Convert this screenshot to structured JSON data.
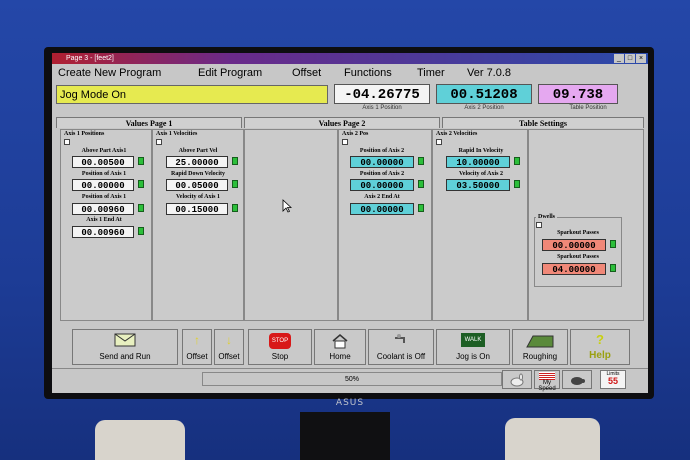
{
  "window": {
    "title": "Page 3 - [feet2]"
  },
  "menu": [
    "Create New Program",
    "Edit Program",
    "Offset",
    "Functions",
    "Timer",
    "Ver 7.0.8"
  ],
  "mode": {
    "text": "Jog Mode On",
    "color": "#e6ea50"
  },
  "positions": [
    {
      "value": "-04.26775",
      "label": "Axis 1 Position",
      "color": "#f4f4f4"
    },
    {
      "value": "00.51208",
      "label": "Axis 2 Position",
      "color": "#5fd0d8"
    },
    {
      "value": "09.738",
      "label": "Table Position",
      "color": "#e5a8f0"
    }
  ],
  "tabs": [
    "Values Page 1",
    "Values Page 2",
    "Table Settings"
  ],
  "axis1_positions": {
    "group": "Axis 1 Positions",
    "fields": [
      {
        "label": "Above Part Axis1",
        "value": "00.00500"
      },
      {
        "label": "Position of Axis 1",
        "value": "00.00000"
      },
      {
        "label": "Position of Axis 1",
        "value": "00.00960"
      },
      {
        "label": "Axis 1 End At",
        "value": "00.00960"
      }
    ]
  },
  "axis1_velocities": {
    "group": "Axis 1 Velocities",
    "fields": [
      {
        "label": "Above Part Vel",
        "value": "25.00000"
      },
      {
        "label": "Rapid Down Velocity",
        "value": "00.05000"
      },
      {
        "label": "Velocity of Axis 1",
        "value": "00.15000"
      }
    ]
  },
  "axis2_pos": {
    "group": "Axis 2 Pos",
    "fields": [
      {
        "label": "Position of Axis 2",
        "value": "00.00000"
      },
      {
        "label": "Position of Axis 2",
        "value": "00.00000"
      },
      {
        "label": "Axis 2 End At",
        "value": "00.00000"
      }
    ]
  },
  "axis2_velocities": {
    "group": "Axis 2 Velocities",
    "fields": [
      {
        "label": "Rapid In Velocity",
        "value": "10.00000"
      },
      {
        "label": "Velocity of Axis 2",
        "value": "03.50000"
      }
    ]
  },
  "dwells": {
    "group": "Dwells",
    "fields": [
      {
        "label": "Sparkout Passes",
        "value": "00.00000"
      },
      {
        "label": "Sparkout Passes",
        "value": "04.00000"
      }
    ]
  },
  "buttons": {
    "send_run": "Send and Run",
    "offset_up": "Offset",
    "offset_down": "Offset",
    "stop": "Stop",
    "stop_icon": "STOP",
    "home": "Home",
    "coolant": "Coolant is Off",
    "jog": "Jog is On",
    "jog_icon": "WALK",
    "roughing": "Roughing",
    "help": "Help"
  },
  "status": {
    "percent": "50%",
    "speed": "My Speed",
    "limit_top": "Limits",
    "limit_val": "55"
  },
  "monitor": {
    "brand": "ASUS"
  }
}
